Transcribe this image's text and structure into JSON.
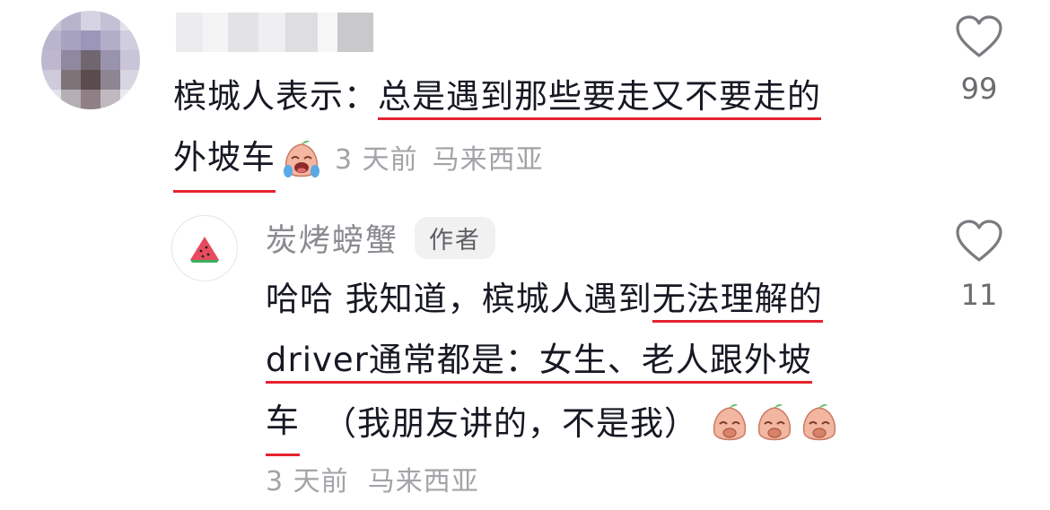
{
  "comment": {
    "text_line1_prefix": "槟城人表示：",
    "text_line1_highlight": "总是遇到那些要走又不要走的",
    "text_line2_highlight": "外坡车",
    "time": "3 天前",
    "location": "马来西亚",
    "likes": "99"
  },
  "reply": {
    "author": "炭烤螃蟹",
    "badge": "作者",
    "line1_prefix": "哈哈 我知道，槟城人遇到",
    "line1_highlight": "无法理解的",
    "line2_prefix": "driver",
    "line2_highlight": "通常都是：女生、老人跟外坡",
    "line3_highlight": "车",
    "line3_rest": "（我朋友讲的，不是我）",
    "time": "3 天前",
    "location": "马来西亚",
    "likes": "11"
  },
  "icons": {
    "like": "heart-outline-icon",
    "emoji_cry": "crying-peach-emoji",
    "emoji_laugh": "laughing-peach-emoji"
  },
  "colors": {
    "highlight_underline": "#e5232f",
    "meta_text": "#a3a3a8",
    "badge_bg": "#f1f1f2"
  }
}
